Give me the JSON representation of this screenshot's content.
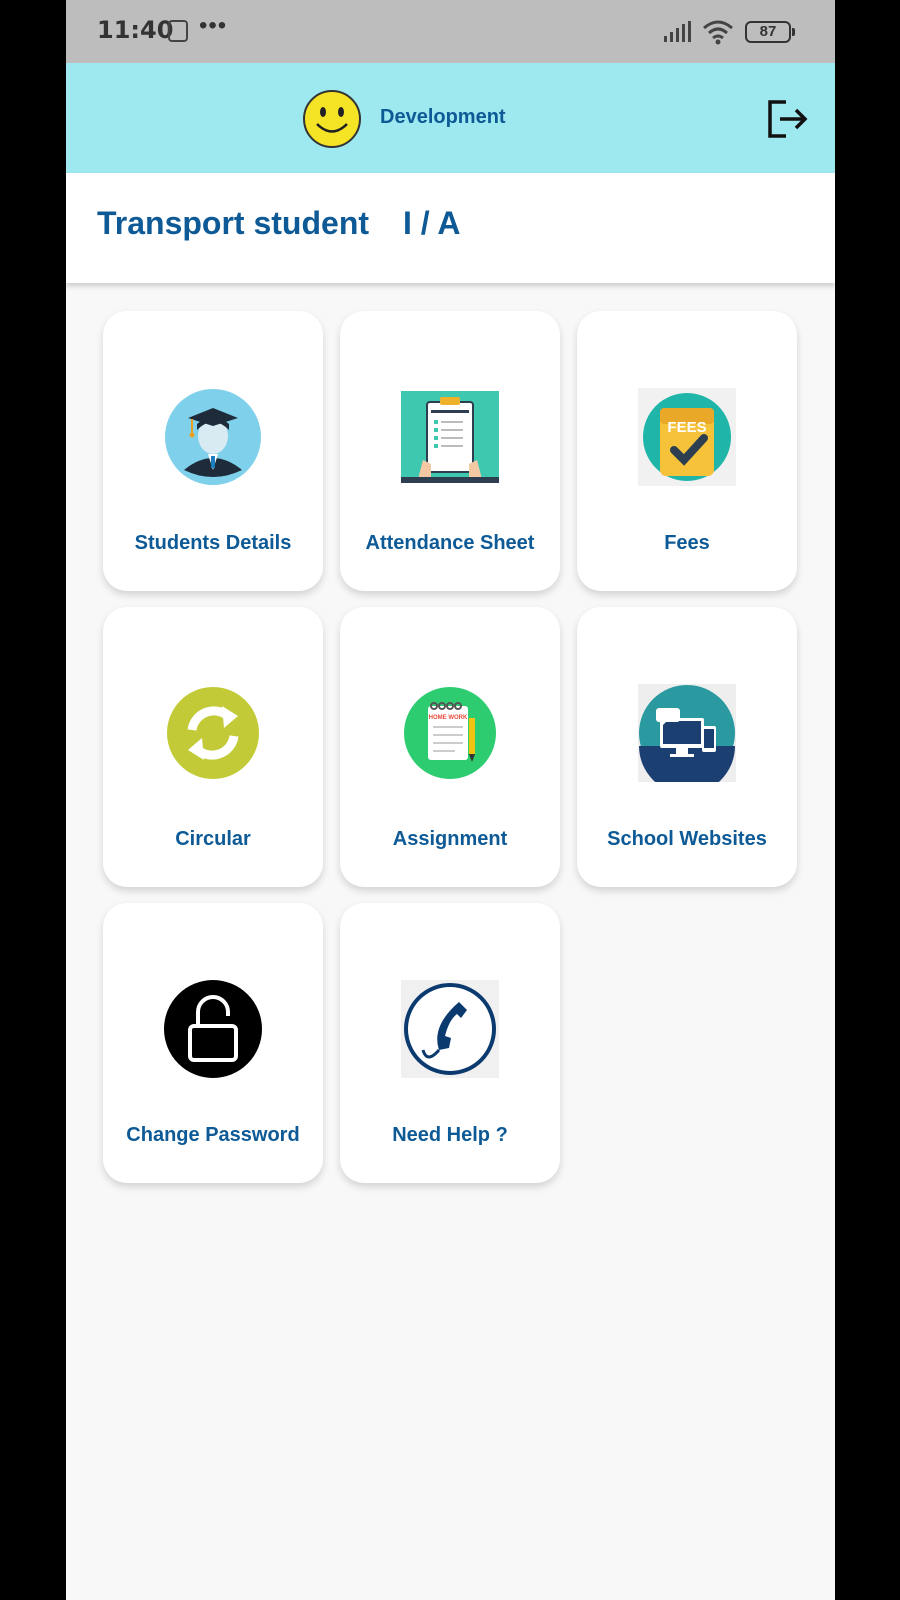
{
  "status_bar": {
    "time": "11:40",
    "dots": "•••",
    "battery": "87"
  },
  "header": {
    "app_name": "Development",
    "logout_icon": "logout-icon",
    "color": "#9ee8ef"
  },
  "title_bar": {
    "title": "Transport student",
    "class": "I / A"
  },
  "tiles": [
    {
      "label": "Students Details",
      "icon": "graduate-icon"
    },
    {
      "label": "Attendance Sheet",
      "icon": "attendance-clipboard-icon"
    },
    {
      "label": "Fees",
      "icon": "fees-icon"
    },
    {
      "label": "Circular",
      "icon": "refresh-circular-icon"
    },
    {
      "label": "Assignment",
      "icon": "homework-notepad-icon"
    },
    {
      "label": "School Websites",
      "icon": "devices-icon"
    },
    {
      "label": "Change Password",
      "icon": "unlock-icon"
    },
    {
      "label": "Need Help ?",
      "icon": "phone-icon"
    }
  ],
  "colors": {
    "accent_text": "#0d5a96",
    "background": "#f8f8f8"
  }
}
